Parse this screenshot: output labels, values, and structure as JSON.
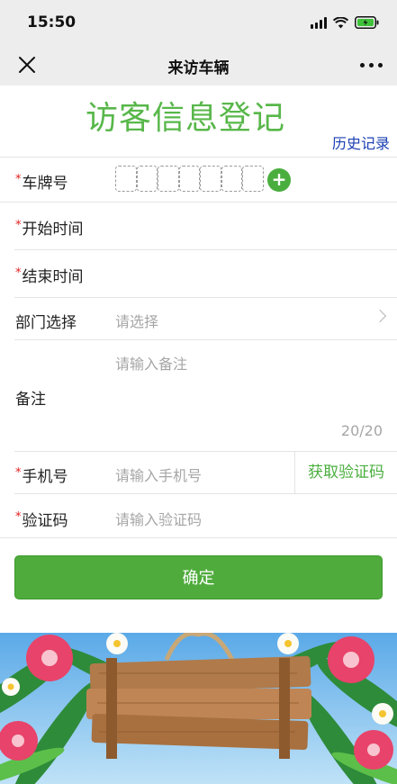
{
  "status_bar": {
    "time": "15:50"
  },
  "nav": {
    "title": "来访车辆"
  },
  "page": {
    "heading": "访客信息登记",
    "history_link": "历史记录"
  },
  "form": {
    "required_mark": "*",
    "plate": {
      "label": "车牌号",
      "add_symbol": "+"
    },
    "start_time": {
      "label": "开始时间"
    },
    "end_time": {
      "label": "结束时间"
    },
    "department": {
      "label": "部门选择",
      "placeholder": "请选择"
    },
    "remark": {
      "label": "备注",
      "placeholder": "请输入备注",
      "counter": "20/20"
    },
    "phone": {
      "label": "手机号",
      "placeholder": "请输入手机号",
      "get_code_label": "获取验证码"
    },
    "verify_code": {
      "label": "验证码",
      "placeholder": "请输入验证码"
    },
    "confirm_label": "确定"
  },
  "colors": {
    "accent_green": "#4fac3c",
    "heading_green": "#58b74a",
    "link_blue": "#1a3fb3",
    "required_red": "#e02020"
  }
}
